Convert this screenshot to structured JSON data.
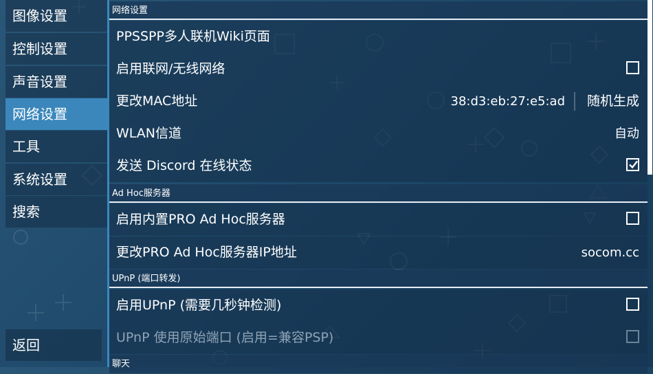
{
  "sidebar": {
    "items": [
      {
        "label": "图像设置"
      },
      {
        "label": "控制设置"
      },
      {
        "label": "声音设置"
      },
      {
        "label": "网络设置",
        "active": true
      },
      {
        "label": "工具"
      },
      {
        "label": "系统设置"
      },
      {
        "label": "搜索"
      }
    ],
    "back_label": "返回"
  },
  "sections": {
    "network": {
      "header": "网络设置",
      "wiki": {
        "label": "PPSSPP多人联机Wiki页面"
      },
      "enable_network": {
        "label": "启用联网/无线网络",
        "checked": false
      },
      "mac": {
        "label": "更改MAC地址",
        "value": "38:d3:eb:27:e5:ad",
        "random_label": "随机生成"
      },
      "wlan_channel": {
        "label": "WLAN信道",
        "value": "自动"
      },
      "discord": {
        "label": "发送 Discord 在线状态",
        "checked": true
      }
    },
    "adhoc": {
      "header": "Ad Hoc服务器",
      "builtin_server": {
        "label": "启用内置PRO Ad Hoc服务器",
        "checked": false
      },
      "server_ip": {
        "label": "更改PRO Ad Hoc服务器IP地址",
        "value": "socom.cc"
      }
    },
    "upnp": {
      "header": "UPnP (端口转发)",
      "enable_upnp": {
        "label": "启用UPnP (需要几秒钟检测)",
        "checked": false
      },
      "original_port": {
        "label": "UPnP 使用原始端口 (启用=兼容PSP)",
        "checked": false,
        "disabled": true
      }
    },
    "chat": {
      "header": "聊天"
    }
  },
  "colors": {
    "accent": "#3b87bc",
    "background": "#1f4a6b",
    "disabled_text": "#8fa3b5"
  }
}
